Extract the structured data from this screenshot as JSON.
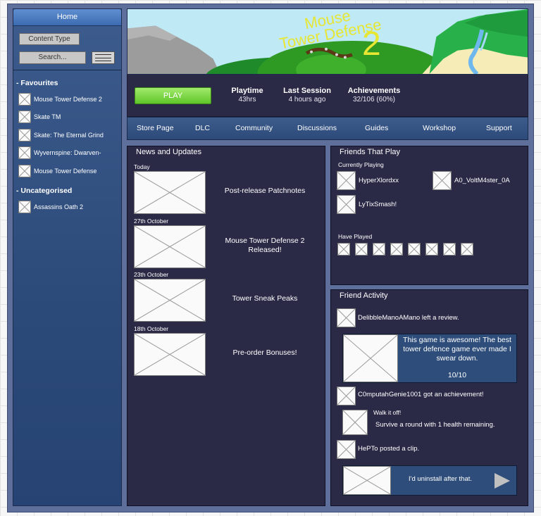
{
  "sidebar": {
    "home_label": "Home",
    "content_type_label": "Content Type",
    "search_placeholder": "Search...",
    "sections": [
      {
        "title": "- Favourites",
        "items": [
          {
            "label": "Mouse Tower Defense 2"
          },
          {
            "label": "Skate TM"
          },
          {
            "label": "Skate: The Eternal Grind"
          },
          {
            "label": "Wyvernspine: Dwarven-"
          },
          {
            "label": "Mouse Tower Defense"
          }
        ]
      },
      {
        "title": "- Uncategorised",
        "items": [
          {
            "label": "Assassins Oath 2"
          }
        ]
      }
    ]
  },
  "banner": {
    "title_line1": "Mouse",
    "title_line2": "Tower Defense",
    "number": "2"
  },
  "playbar": {
    "play_label": "PLAY",
    "stats": [
      {
        "title": "Playtime",
        "value": "43hrs"
      },
      {
        "title": "Last Session",
        "value": "4 hours ago"
      },
      {
        "title": "Achievements",
        "value": "32/106 (60%)"
      }
    ]
  },
  "nav": {
    "tabs": [
      "Store Page",
      "DLC",
      "Community",
      "Discussions",
      "Guides",
      "Workshop",
      "Support"
    ]
  },
  "news": {
    "title": "News and Updates",
    "items": [
      {
        "date": "Today",
        "caption": "Post-release Patchnotes"
      },
      {
        "date": "27th October",
        "caption": "Mouse Tower Defense 2 Released!"
      },
      {
        "date": "23th October",
        "caption": "Tower Sneak Peaks"
      },
      {
        "date": "18th October",
        "caption": "Pre-order Bonuses!"
      }
    ]
  },
  "friends_play": {
    "title": "Friends That Play",
    "currently_playing_label": "Currently Playing",
    "currently_playing": [
      "HyperXlordxx",
      "A0_VoltM4ster_0A",
      "LyTixSmash!"
    ],
    "have_played_label": "Have Played"
  },
  "activity": {
    "title": "Friend Activity",
    "review_event": "DelibbleManoAMano left a review.",
    "review_text": "This game is awesome! The best tower defence game ever made I swear down.",
    "review_score": "10/10",
    "achievement_event": "C0mputahGenie1001 got an achievement!",
    "achievement_name": "Walk it off!",
    "achievement_desc": "Survive a round with 1 health remaining.",
    "clip_event": "HePTo posted a clip.",
    "clip_caption": "I'd uninstall after that."
  }
}
